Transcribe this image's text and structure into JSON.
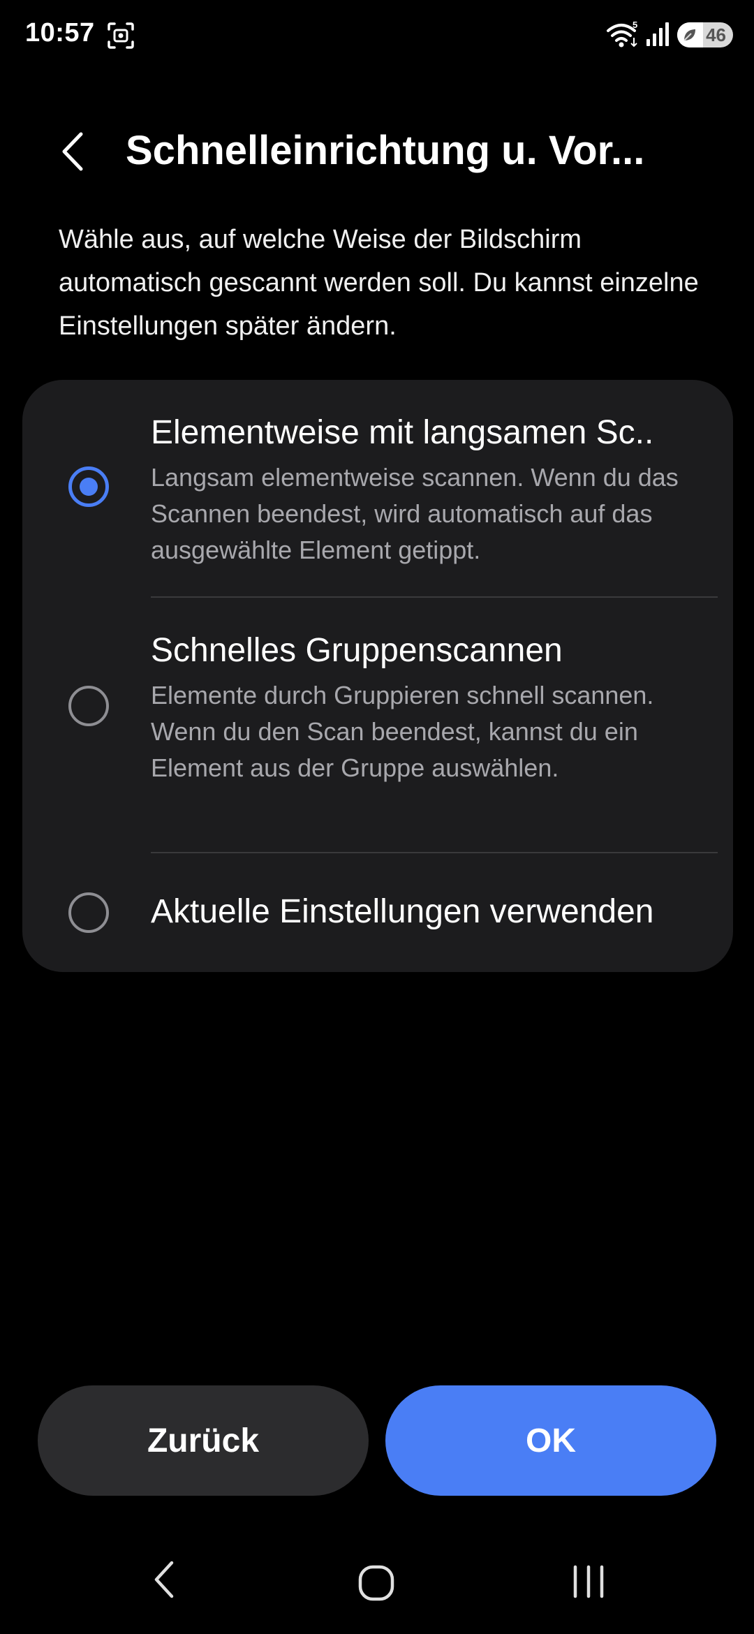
{
  "status_bar": {
    "time": "10:57",
    "wifi_badge": "5",
    "battery_percent": "46",
    "battery_level": 0.46
  },
  "header": {
    "title": "Schnelleinrichtung u. Vor..."
  },
  "description": "Wähle aus, auf welche Weise der Bildschirm automatisch gescannt werden soll. Du kannst einzelne Einstellungen später ändern.",
  "options": [
    {
      "title": "Elementweise mit langsamen Sc..",
      "description": "Langsam elementweise scannen. Wenn du das Scannen beendest, wird automatisch auf das ausgewählte Element getippt.",
      "selected": true
    },
    {
      "title": "Schnelles Gruppenscannen",
      "description": "Elemente durch Gruppieren schnell scannen. Wenn du den Scan beendest, kannst du ein Element aus der Gruppe auswählen.",
      "selected": false
    },
    {
      "title": "Aktuelle Einstellungen verwenden",
      "description": "",
      "selected": false
    }
  ],
  "buttons": {
    "back_label": "Zurück",
    "ok_label": "OK"
  },
  "colors": {
    "accent": "#4a7ef5",
    "card": "#1c1c1e",
    "secondary_button": "#2c2c2e"
  }
}
